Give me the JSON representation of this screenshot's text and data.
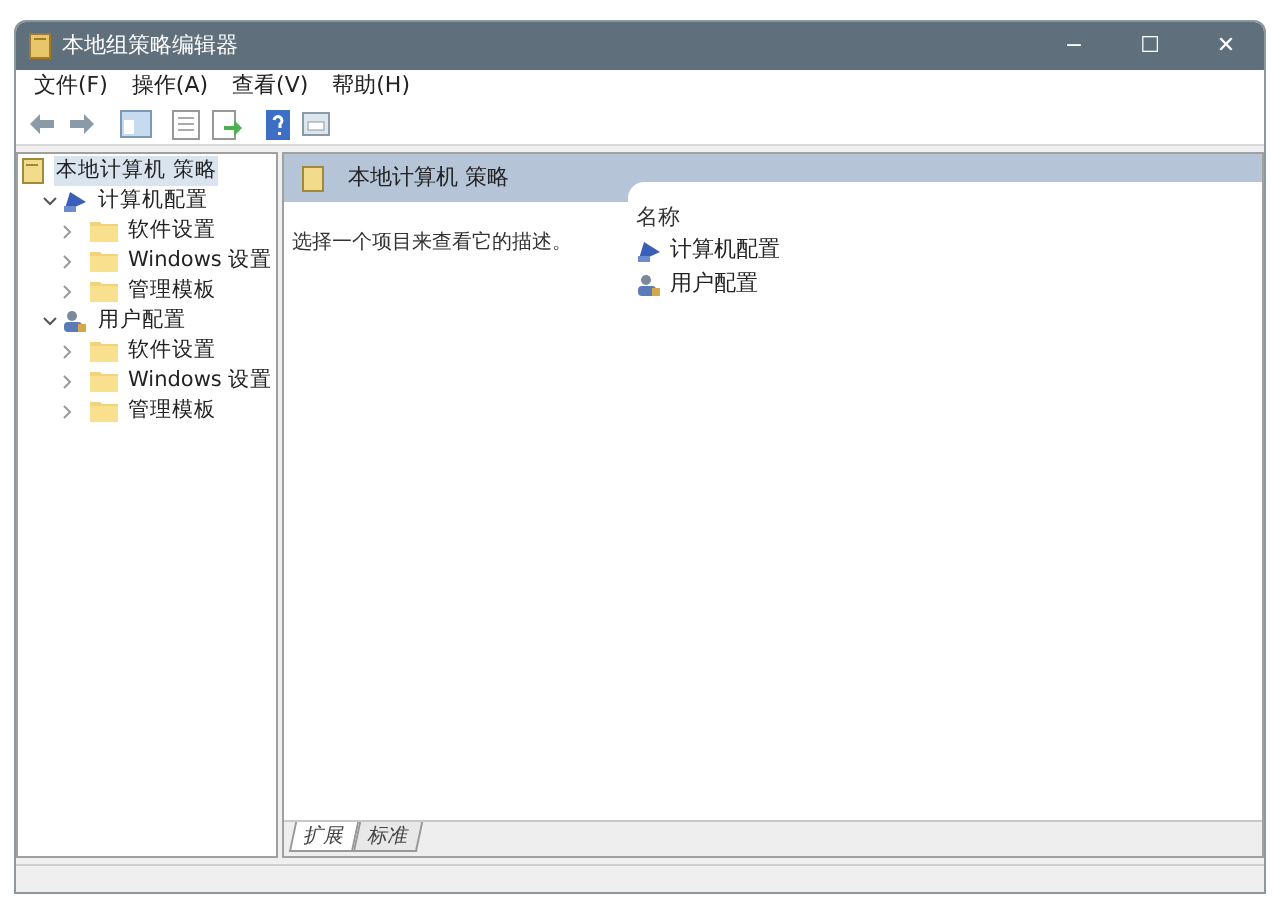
{
  "window": {
    "title": "本地组策略编辑器",
    "controls": [
      "−",
      "☐",
      "✕"
    ]
  },
  "menu": [
    "文件(F)",
    "操作(A)",
    "查看(V)",
    "帮助(H)"
  ],
  "tree": [
    {
      "label": "本地计算机 策略",
      "kind": "policy",
      "selected": true,
      "children": [
        {
          "label": "计算机配置",
          "kind": "computer",
          "selected": false,
          "expanded": true,
          "children": [
            {
              "label": "软件设置",
              "kind": "folder",
              "selected": false,
              "expanded": false
            },
            {
              "label": "Windows 设置",
              "kind": "folder",
              "selected": false,
              "expanded": false
            },
            {
              "label": "管理模板",
              "kind": "folder",
              "selected": false,
              "expanded": false
            }
          ]
        },
        {
          "label": "用户配置",
          "kind": "user",
          "selected": false,
          "expanded": true,
          "children": [
            {
              "label": "软件设置",
              "kind": "folder",
              "selected": false,
              "expanded": false
            },
            {
              "label": "Windows 设置",
              "kind": "folder",
              "selected": false,
              "expanded": false
            },
            {
              "label": "管理模板",
              "kind": "folder",
              "selected": false,
              "expanded": false
            }
          ]
        }
      ]
    }
  ],
  "details": {
    "header": "本地计算机 策略",
    "description": "选择一个项目来查看它的描述。",
    "column": "名称",
    "items": [
      {
        "label": "计算机配置",
        "kind": "computer"
      },
      {
        "label": "用户配置",
        "kind": "user"
      }
    ]
  },
  "view_tabs": [
    {
      "label": "扩展",
      "selected": true
    },
    {
      "label": "标准",
      "selected": false
    }
  ]
}
